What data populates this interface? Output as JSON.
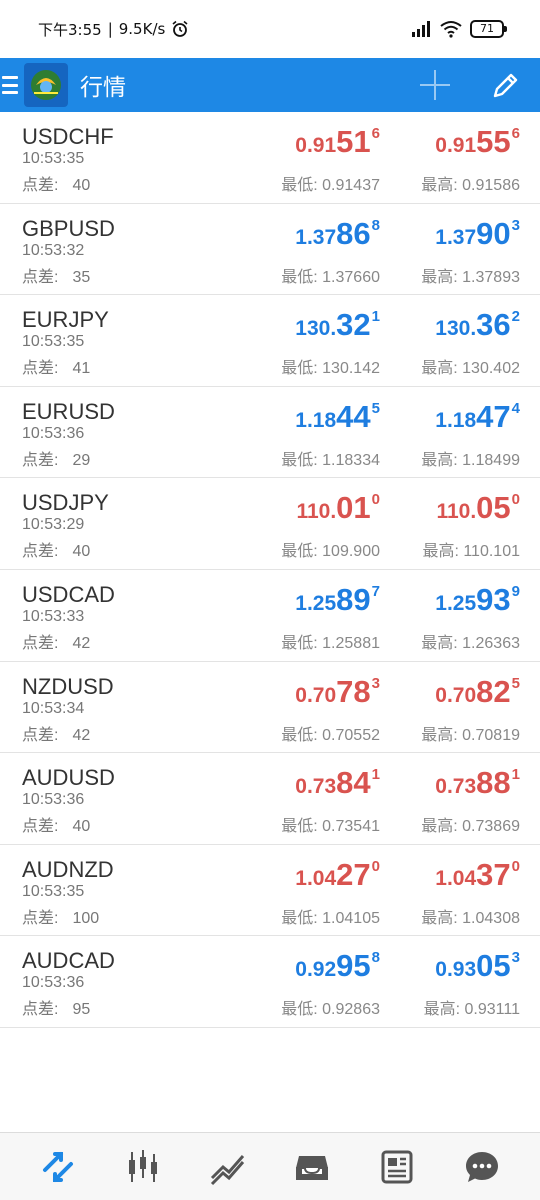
{
  "status": {
    "time": "下午3:55",
    "speed": "9.5K/s",
    "battery": "71"
  },
  "header": {
    "title": "行情"
  },
  "labels": {
    "spread": "点差:",
    "low": "最低:",
    "high": "最高:"
  },
  "quotes": [
    {
      "symbol": "USDCHF",
      "time": "10:53:35",
      "spread": "40",
      "bid": {
        "pre": "0.91",
        "big": "51",
        "sup": "6"
      },
      "ask": {
        "pre": "0.91",
        "big": "55",
        "sup": "6"
      },
      "low": "0.91437",
      "high": "0.91586",
      "trend": "down"
    },
    {
      "symbol": "GBPUSD",
      "time": "10:53:32",
      "spread": "35",
      "bid": {
        "pre": "1.37",
        "big": "86",
        "sup": "8"
      },
      "ask": {
        "pre": "1.37",
        "big": "90",
        "sup": "3"
      },
      "low": "1.37660",
      "high": "1.37893",
      "trend": "up"
    },
    {
      "symbol": "EURJPY",
      "time": "10:53:35",
      "spread": "41",
      "bid": {
        "pre": "130.",
        "big": "32",
        "sup": "1"
      },
      "ask": {
        "pre": "130.",
        "big": "36",
        "sup": "2"
      },
      "low": "130.142",
      "high": "130.402",
      "trend": "up"
    },
    {
      "symbol": "EURUSD",
      "time": "10:53:36",
      "spread": "29",
      "bid": {
        "pre": "1.18",
        "big": "44",
        "sup": "5"
      },
      "ask": {
        "pre": "1.18",
        "big": "47",
        "sup": "4"
      },
      "low": "1.18334",
      "high": "1.18499",
      "trend": "up"
    },
    {
      "symbol": "USDJPY",
      "time": "10:53:29",
      "spread": "40",
      "bid": {
        "pre": "110.",
        "big": "01",
        "sup": "0"
      },
      "ask": {
        "pre": "110.",
        "big": "05",
        "sup": "0"
      },
      "low": "109.900",
      "high": "110.101",
      "trend": "down"
    },
    {
      "symbol": "USDCAD",
      "time": "10:53:33",
      "spread": "42",
      "bid": {
        "pre": "1.25",
        "big": "89",
        "sup": "7"
      },
      "ask": {
        "pre": "1.25",
        "big": "93",
        "sup": "9"
      },
      "low": "1.25881",
      "high": "1.26363",
      "trend": "up"
    },
    {
      "symbol": "NZDUSD",
      "time": "10:53:34",
      "spread": "42",
      "bid": {
        "pre": "0.70",
        "big": "78",
        "sup": "3"
      },
      "ask": {
        "pre": "0.70",
        "big": "82",
        "sup": "5"
      },
      "low": "0.70552",
      "high": "0.70819",
      "trend": "down"
    },
    {
      "symbol": "AUDUSD",
      "time": "10:53:36",
      "spread": "40",
      "bid": {
        "pre": "0.73",
        "big": "84",
        "sup": "1"
      },
      "ask": {
        "pre": "0.73",
        "big": "88",
        "sup": "1"
      },
      "low": "0.73541",
      "high": "0.73869",
      "trend": "down"
    },
    {
      "symbol": "AUDNZD",
      "time": "10:53:35",
      "spread": "100",
      "bid": {
        "pre": "1.04",
        "big": "27",
        "sup": "0"
      },
      "ask": {
        "pre": "1.04",
        "big": "37",
        "sup": "0"
      },
      "low": "1.04105",
      "high": "1.04308",
      "trend": "down"
    },
    {
      "symbol": "AUDCAD",
      "time": "10:53:36",
      "spread": "95",
      "bid": {
        "pre": "0.92",
        "big": "95",
        "sup": "8"
      },
      "ask": {
        "pre": "0.93",
        "big": "05",
        "sup": "3"
      },
      "low": "0.92863",
      "high": "0.93111",
      "trend": "up"
    }
  ],
  "bottom_nav": [
    {
      "icon": "quotes-icon",
      "active": true
    },
    {
      "icon": "chart-icon",
      "active": false
    },
    {
      "icon": "trade-icon",
      "active": false
    },
    {
      "icon": "history-icon",
      "active": false
    },
    {
      "icon": "news-icon",
      "active": false
    },
    {
      "icon": "chat-icon",
      "active": false
    }
  ],
  "colors": {
    "accent": "#1e88e5",
    "up": "#1e7de0",
    "down": "#d9534f"
  }
}
